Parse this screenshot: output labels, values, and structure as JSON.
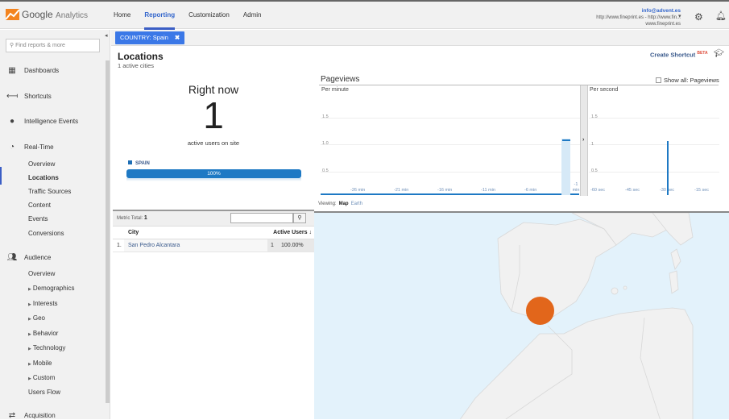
{
  "app": {
    "brand": "Google",
    "product": "Analytics",
    "nav": [
      "Home",
      "Reporting",
      "Customization",
      "Admin"
    ],
    "active_nav": "Reporting",
    "account": {
      "email": "info@advent.es",
      "property": "http://www.fineprint.es - http://www.fin...",
      "view": "www.fineprint.es"
    },
    "icons": {
      "settings": "gear-icon",
      "notifications": "bell-icon"
    }
  },
  "sidebar": {
    "search_placeholder": "Find reports & more",
    "sections": [
      {
        "label": "Dashboards",
        "icon": "grid-icon"
      },
      {
        "label": "Shortcuts",
        "icon": "arrow-left-icon"
      },
      {
        "label": "Intelligence Events",
        "icon": "lightbulb-icon"
      },
      {
        "label": "Real-Time",
        "icon": "clock-icon"
      },
      {
        "label": "Audience",
        "icon": "people-icon"
      },
      {
        "label": "Acquisition",
        "icon": "acquisition-icon"
      }
    ],
    "realtime_items": [
      "Overview",
      "Locations",
      "Traffic Sources",
      "Content",
      "Events",
      "Conversions"
    ],
    "active_item": "Locations",
    "audience_items": [
      "Overview",
      "Demographics",
      "Interests",
      "Geo",
      "Behavior",
      "Technology",
      "Mobile",
      "Custom",
      "Users Flow"
    ]
  },
  "filter": {
    "label": "COUNTRY: Spain",
    "close": "✖"
  },
  "page": {
    "title": "Locations",
    "subtitle": "1 active cities",
    "create_shortcut": "Create Shortcut",
    "beta": "BETA"
  },
  "rightnow": {
    "heading": "Right now",
    "count": "1",
    "label": "active users on site",
    "country": "SPAIN",
    "percent_label": "100%",
    "percent": 100
  },
  "pageviews": {
    "title": "Pageviews",
    "show_all": "Show all: Pageviews",
    "per_minute": {
      "label": "Per minute",
      "y_ticks": [
        "1.5",
        "1.0",
        "0.5"
      ],
      "x_ticks": [
        "-26 min",
        "-21 min",
        "-16 min",
        "-11 min",
        "-6 min",
        "-1 min"
      ],
      "values_last": 1
    },
    "per_second": {
      "label": "Per second",
      "y_ticks": [
        "1.5",
        "1",
        "0.5"
      ],
      "x_ticks": [
        "-60 sec",
        "-45 sec",
        "-30 sec",
        "-15 sec"
      ],
      "spike_at": "-30 sec",
      "spike_value": 1
    }
  },
  "viewing": {
    "label": "Viewing:",
    "options": [
      "Map",
      "Earth"
    ],
    "active": "Map"
  },
  "table": {
    "metric_total_label": "Metric Total:",
    "metric_total": "1",
    "columns": [
      "City",
      "Active Users ↓"
    ],
    "rows": [
      {
        "index": "1.",
        "city": "San Pedro Alcantara",
        "users": "1",
        "pct": "100.00%"
      }
    ]
  },
  "map": {
    "bubble_color": "#e2661b",
    "sea_color": "#e3f2fb",
    "land_color": "#f1f1f1"
  }
}
